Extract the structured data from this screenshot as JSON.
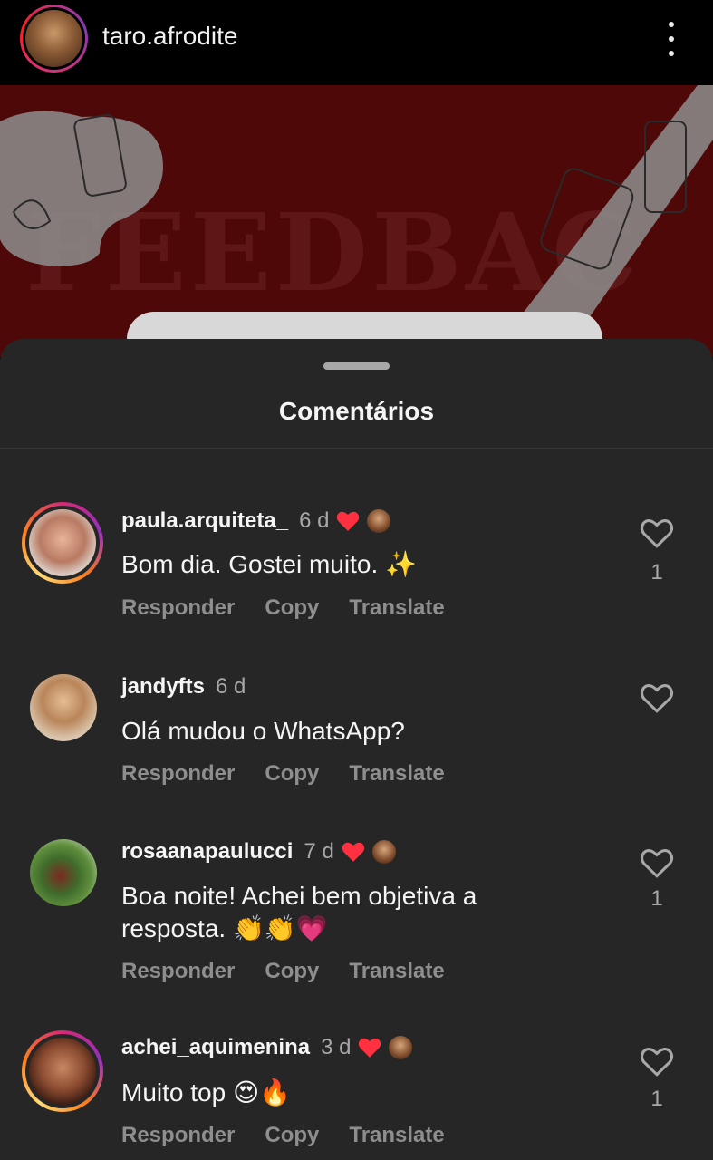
{
  "header": {
    "username": "taro.afrodite"
  },
  "post": {
    "overlay_text": "FEEDBAC"
  },
  "sheet": {
    "title": "Comentários"
  },
  "comments": [
    {
      "username": "paula.arquiteta_",
      "time": "6 d",
      "liked_by_author": true,
      "text": "Bom dia. Gostei muito. ✨",
      "likes": "1",
      "reply": "Responder",
      "copy": "Copy",
      "translate": "Translate",
      "has_story_ring": true
    },
    {
      "username": "jandyfts",
      "time": "6 d",
      "liked_by_author": false,
      "text": "Olá mudou o WhatsApp?",
      "likes": "",
      "reply": "Responder",
      "copy": "Copy",
      "translate": "Translate",
      "has_story_ring": false
    },
    {
      "username": "rosaanapaulucci",
      "time": "7 d",
      "liked_by_author": true,
      "text_line1": "Boa noite! Achei bem objetiva a",
      "text_line2": "resposta. 👏👏💗",
      "likes": "1",
      "reply": "Responder",
      "copy": "Copy",
      "translate": "Translate",
      "has_story_ring": false
    },
    {
      "username": "achei_aquimenina",
      "time": "3 d",
      "liked_by_author": true,
      "text": "Muito top 😍🔥",
      "likes": "1",
      "reply": "Responder",
      "copy": "Copy",
      "translate": "Translate",
      "has_story_ring": true
    }
  ],
  "colors": {
    "sheet_bg": "#262626",
    "post_bg": "#4e0808",
    "like_red": "#ff3040",
    "muted": "#8e8e8e"
  }
}
